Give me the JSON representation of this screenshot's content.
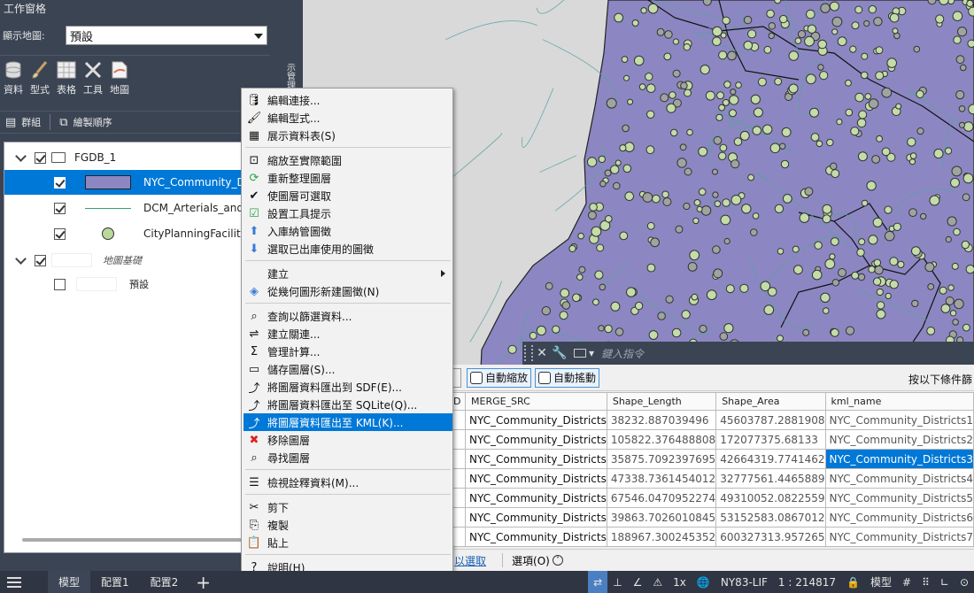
{
  "taskpane": {
    "title": "工作窗格",
    "display_map_label": "顯示地圖:",
    "display_map_value": "預設",
    "ribbon": [
      {
        "label": "資料",
        "icon": "data-icon"
      },
      {
        "label": "型式",
        "icon": "style-brush-icon"
      },
      {
        "label": "表格",
        "icon": "table-icon"
      },
      {
        "label": "工具",
        "icon": "tools-icon"
      },
      {
        "label": "地圖",
        "icon": "map-icon"
      }
    ],
    "side_tab_label": "示管理員",
    "group_label": "群組",
    "draw_order_label": "繪製順序"
  },
  "tree": {
    "group_name": "FGDB_1",
    "layers": [
      {
        "name": "NYC_Community_Districts",
        "visible_text": "NYC_Community_Dis"
      },
      {
        "name": "DCM_Arterials_and_Major_Streets",
        "visible_text": "DCM_Arterials_and_M"
      },
      {
        "name": "CityPlanningFacilities",
        "visible_text": "CityPlanningFacilities"
      }
    ],
    "base_map_label": "地圖基礎",
    "default_label": "預設"
  },
  "context_menu": [
    {
      "label": "編輯連接...",
      "icon": "database-icon",
      "type": "item"
    },
    {
      "label": "編輯型式...",
      "icon": "brush-icon",
      "type": "item"
    },
    {
      "label": "展示資料表(S)",
      "icon": "table-icon",
      "type": "item"
    },
    {
      "type": "sep"
    },
    {
      "label": "縮放至實際範圍",
      "icon": "zoom-extents-icon",
      "type": "item"
    },
    {
      "label": "重新整理圖層",
      "icon": "refresh-icon",
      "type": "item"
    },
    {
      "label": "使圖層可選取",
      "icon": "check-icon",
      "type": "item"
    },
    {
      "label": "設置工具提示",
      "icon": "tooltip-icon",
      "type": "item"
    },
    {
      "label": "入庫納管圖徵",
      "icon": "checkin-icon",
      "type": "item"
    },
    {
      "label": "選取已出庫使用的圖徵",
      "icon": "select-checkout-icon",
      "type": "item"
    },
    {
      "type": "sep"
    },
    {
      "label": "建立",
      "icon": "",
      "type": "submenu"
    },
    {
      "label": "從幾何圖形新建圖徵(N)",
      "icon": "geometry-icon",
      "type": "item"
    },
    {
      "type": "sep"
    },
    {
      "label": "查詢以篩選資料...",
      "icon": "query-icon",
      "type": "item"
    },
    {
      "label": "建立關連...",
      "icon": "join-icon",
      "type": "item"
    },
    {
      "label": "管理計算...",
      "icon": "calc-icon",
      "type": "item"
    },
    {
      "label": "儲存圖層(S)...",
      "icon": "save-layer-icon",
      "type": "item"
    },
    {
      "label": "將圖層資料匯出到 SDF(E)...",
      "icon": "export-icon",
      "type": "item"
    },
    {
      "label": "將圖層資料匯出至 SQLite(Q)...",
      "icon": "export-icon",
      "type": "item"
    },
    {
      "label": "將圖層資料匯出至 KML(K)...",
      "icon": "export-icon",
      "type": "item",
      "highlight": true
    },
    {
      "label": "移除圖層",
      "icon": "remove-icon",
      "type": "item"
    },
    {
      "label": "尋找圖層",
      "icon": "find-layer-icon",
      "type": "item"
    },
    {
      "type": "sep"
    },
    {
      "label": "檢視詮釋資料(M)...",
      "icon": "metadata-icon",
      "type": "item"
    },
    {
      "type": "sep"
    },
    {
      "label": "剪下",
      "icon": "cut-icon",
      "type": "item"
    },
    {
      "label": "複製",
      "icon": "copy-icon",
      "type": "item"
    },
    {
      "label": "貼上",
      "icon": "paste-icon",
      "type": "item"
    },
    {
      "type": "sep"
    },
    {
      "label": "說明(H)",
      "icon": "help-icon",
      "type": "item"
    }
  ],
  "command_line": {
    "placeholder": "鍵入指令"
  },
  "data_table": {
    "auto_zoom_label": "自動縮放",
    "auto_pan_label": "自動搖動",
    "filter_label": "按以下條件篩",
    "columns": [
      "D",
      "MERGE_SRC",
      "Shape_Length",
      "Shape_Area",
      "kml_name"
    ],
    "rows": [
      [
        "",
        "NYC_Community_Districts",
        "38232.887039496",
        "45603787.2881908",
        "NYC_Community_Districts1"
      ],
      [
        "",
        "NYC_Community_Districts",
        "105822.376488808",
        "172077375.68133",
        "NYC_Community_Districts2"
      ],
      [
        "",
        "NYC_Community_Districts",
        "35875.7092397695",
        "42664319.7741462",
        "NYC_Community_Districts3"
      ],
      [
        "",
        "NYC_Community_Districts",
        "47338.7361454012",
        "32777561.4465889",
        "NYC_Community_Districts4"
      ],
      [
        "",
        "NYC_Community_Districts",
        "67546.0470952274",
        "49310052.0822559",
        "NYC_Community_Districts5"
      ],
      [
        "",
        "NYC_Community_Districts",
        "39863.7026010845",
        "53152583.0867012",
        "NYC_Community_Districts6"
      ],
      [
        "",
        "NYC_Community_Districts",
        "188967.300245352",
        "600327313.957265",
        "NYC_Community_Districts7"
      ]
    ],
    "footer_link": "以選取",
    "options_label": "選項(O)"
  },
  "status_bar": {
    "tabs": [
      "模型",
      "配置1",
      "配置2"
    ],
    "scale_factor": "1x",
    "coord_system": "NY83-LIF",
    "map_scale": "1 : 214817",
    "model_label": "模型"
  },
  "colors": {
    "pane_bg": "#3b4453",
    "polygon_fill": "#8c87c2",
    "facility_fill": "#b8d99a",
    "street_line": "#2ea371",
    "selection": "#0078d7"
  }
}
